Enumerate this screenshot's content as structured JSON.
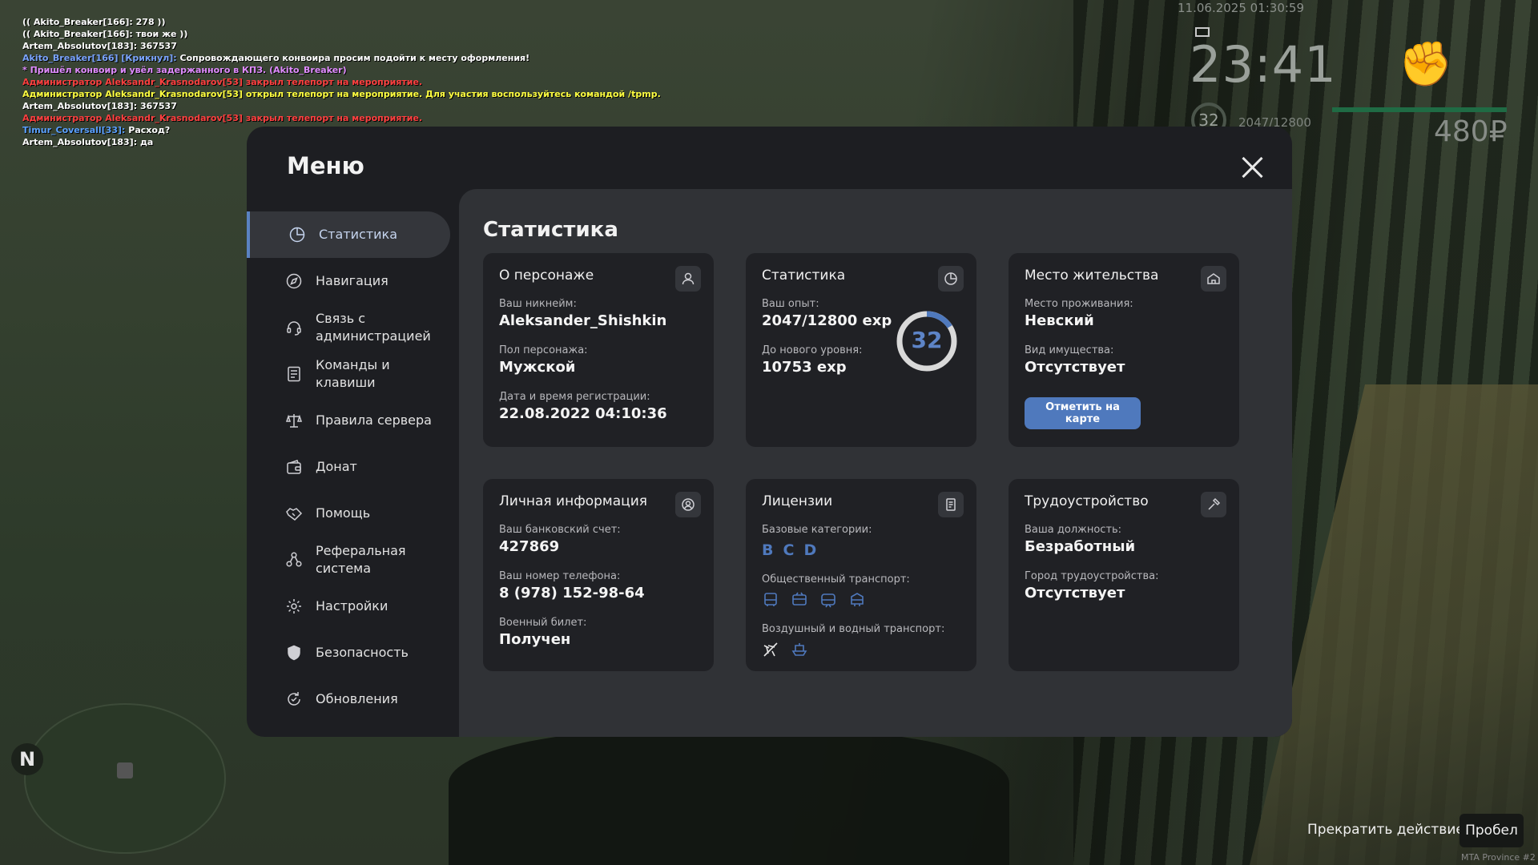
{
  "chat": [
    {
      "text": "(( Akito_Breaker[166]: 278 ))",
      "color": "#ffffff"
    },
    {
      "text": "(( Akito_Breaker[166]: твои же ))",
      "color": "#ffffff"
    },
    {
      "text": "Artem_Absolutov[183]: 367537",
      "color": "#ffffff"
    },
    {
      "text": "Akito_Breaker[166] [Крикнул]: Сопровождающего конвоира просим подойти к месту оформления!",
      "color": "#ffffff",
      "prefix": "Akito_Breaker[166] [Крикнул]:",
      "prefix_color": "#7aa4ff"
    },
    {
      "text": "* Пришёл конвоир и увёл задержанного в КПЗ. (Akito_Breaker)",
      "color": "#e08cff"
    },
    {
      "text": "Администратор Aleksandr_Krasnodarov[53] закрыл телепорт на мероприятие.",
      "color": "#ff4040"
    },
    {
      "text": "Администратор Aleksandr_Krasnodarov[53] открыл телепорт на мероприятие. Для участия воспользуйтесь командой /tpmp.",
      "color": "#ffff40"
    },
    {
      "text": "Artem_Absolutov[183]: 367537",
      "color": "#ffffff"
    },
    {
      "text": "Администратор Aleksandr_Krasnodarov[53] закрыл телепорт на мероприятие.",
      "color": "#ff4040"
    },
    {
      "text": "Timur_Coversall[33]: Расход?",
      "color": "#ffffff",
      "prefix": "Timur_Coversall[33]:",
      "prefix_color": "#5aa0ff"
    },
    {
      "text": "Artem_Absolutov[183]: да",
      "color": "#ffffff"
    }
  ],
  "hud": {
    "date": "11.06.2025 01:30:59",
    "time": "23:41",
    "level": "32",
    "exp": "2047/12800",
    "money": "480₽",
    "health_percent": 100
  },
  "minimap": {
    "north": "N"
  },
  "bottom": {
    "stop_action": "Прекратить действие",
    "key": "Пробел",
    "watermark": "MTA Province #2"
  },
  "menu": {
    "title": "Меню",
    "sidebar": [
      {
        "label": "Статистика",
        "icon": "pie-chart-icon",
        "active": true
      },
      {
        "label": "Навигация",
        "icon": "compass-icon"
      },
      {
        "label": "Связь с\nадминистрацией",
        "icon": "headset-icon"
      },
      {
        "label": "Команды и\nклавиши",
        "icon": "document-icon"
      },
      {
        "label": "Правила сервера",
        "icon": "scales-icon"
      },
      {
        "label": "Донат",
        "icon": "wallet-icon"
      },
      {
        "label": "Помощь",
        "icon": "handshake-icon"
      },
      {
        "label": "Реферальная\nсистема",
        "icon": "referral-icon"
      },
      {
        "label": "Настройки",
        "icon": "gear-icon"
      },
      {
        "label": "Безопасность",
        "icon": "shield-icon"
      },
      {
        "label": "Обновления",
        "icon": "update-icon"
      }
    ],
    "content_title": "Статистика",
    "cards": {
      "character": {
        "title": "О персонаже",
        "nick_label": "Ваш никнейм:",
        "nick": "Aleksander_Shishkin",
        "gender_label": "Пол персонажа:",
        "gender": "Мужской",
        "reg_label": "Дата и время регистрации:",
        "reg": "22.08.2022 04:10:36"
      },
      "stats": {
        "title": "Статистика",
        "exp_label": "Ваш опыт:",
        "exp": "2047/12800 exp",
        "next_label": "До нового уровня:",
        "next": "10753 exp",
        "level": "32",
        "progress_fraction": 0.16
      },
      "residence": {
        "title": "Место жительства",
        "place_label": "Место проживания:",
        "place": "Невский",
        "property_label": "Вид имущества:",
        "property": "Отсутствует",
        "button": "Отметить на карте"
      },
      "personal": {
        "title": "Личная информация",
        "bank_label": "Ваш банковский счет:",
        "bank": "427869",
        "phone_label": "Ваш номер телефона:",
        "phone": "8 (978) 152-98-64",
        "military_label": "Военный билет:",
        "military": "Получен"
      },
      "licenses": {
        "title": "Лицензии",
        "basic_label": "Базовые категории:",
        "basic": [
          "B",
          "C",
          "D"
        ],
        "public_label": "Общественный транспорт:",
        "public_icons": [
          "bus-icon",
          "trolleybus-icon",
          "tram-icon",
          "minibus-icon"
        ],
        "air_label": "Воздушный и водный транспорт:",
        "air_icons": [
          "plane-icon",
          "boat-icon"
        ]
      },
      "job": {
        "title": "Трудоустройство",
        "position_label": "Ваша должность:",
        "position": "Безработный",
        "city_label": "Город трудоустройства:",
        "city": "Отсутствует"
      }
    }
  },
  "colors": {
    "accent": "#4f79bd",
    "panel": "#1d1e22",
    "content": "#303236",
    "card": "#202125"
  }
}
